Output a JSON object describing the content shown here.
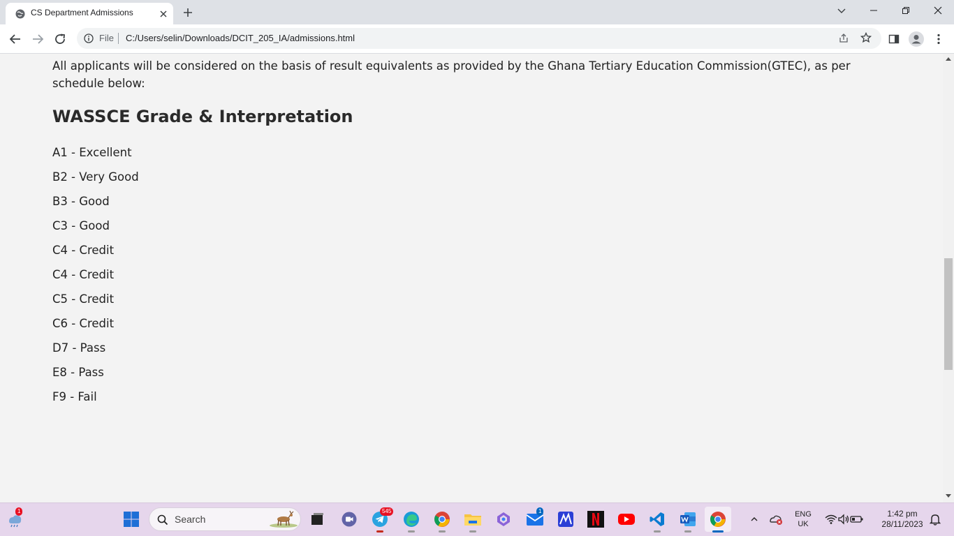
{
  "browser": {
    "tab_title": "CS Department Admissions",
    "omnibox_scheme": "File",
    "omnibox_url": "C:/Users/selin/Downloads/DCIT_205_IA/admissions.html"
  },
  "page": {
    "intro": "All applicants will be considered on the basis of result equivalents as provided by the Ghana Tertiary Education Commission(GTEC), as per schedule below:",
    "heading": "WASSCE Grade & Interpretation",
    "grades": [
      "A1 - Excellent",
      "B2 - Very Good",
      "B3 - Good",
      "C3 - Good",
      "C4 - Credit",
      "C4 - Credit",
      "C5 - Credit",
      "C6 - Credit",
      "D7 - Pass",
      "E8 - Pass",
      "F9 - Fail"
    ]
  },
  "taskbar": {
    "search_label": "Search",
    "widgets_badge": "1",
    "telegram_badge": "545",
    "mail_badge": "1",
    "language": "ENG",
    "region": "UK",
    "time": "1:42 pm",
    "date": "28/11/2023"
  },
  "colors": {
    "page_background": "#f3f3f3",
    "tabstrip": "#dee1e6",
    "taskbar": "#e6d6ec"
  }
}
